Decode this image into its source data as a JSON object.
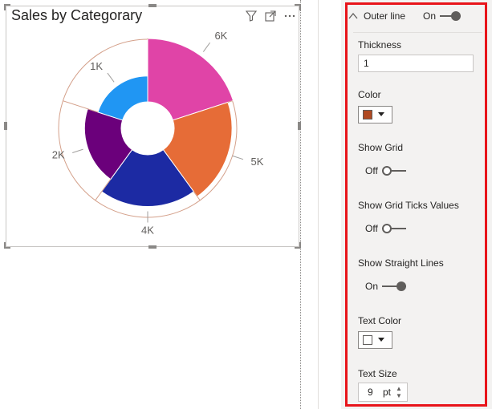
{
  "visual": {
    "title": "Sales by Categorary",
    "header_icons": [
      "filter-icon",
      "focus-mode-icon",
      "more-options-icon"
    ]
  },
  "chart_data": {
    "type": "pie",
    "subtype": "rose-donut",
    "categories": [
      "",
      "",
      "",
      "",
      ""
    ],
    "values": [
      6000,
      5000,
      4000,
      2000,
      1000
    ],
    "data_labels": [
      "6K",
      "5K",
      "4K",
      "2K",
      "1K"
    ],
    "colors": [
      "#e044a7",
      "#e66c37",
      "#1c2aa3",
      "#6b007b",
      "#2096f3"
    ],
    "outer_line_color": "#d4a08a",
    "show_grid": false,
    "show_straight_lines": true
  },
  "format_pane": {
    "section": {
      "name": "Outer line",
      "toggle_label": "On",
      "expanded_icon": "chevron-up-icon"
    },
    "thickness": {
      "label": "Thickness",
      "value": "1"
    },
    "color": {
      "label": "Color",
      "swatch": "#b04a22"
    },
    "show_grid": {
      "label": "Show Grid",
      "state": "Off"
    },
    "show_grid_ticks": {
      "label": "Show Grid Ticks Values",
      "state": "Off"
    },
    "show_straight_lines": {
      "label": "Show Straight Lines",
      "state": "On"
    },
    "text_color": {
      "label": "Text Color",
      "swatch": "#ffffff"
    },
    "text_size": {
      "label": "Text Size",
      "value": "9",
      "unit": "pt"
    }
  }
}
